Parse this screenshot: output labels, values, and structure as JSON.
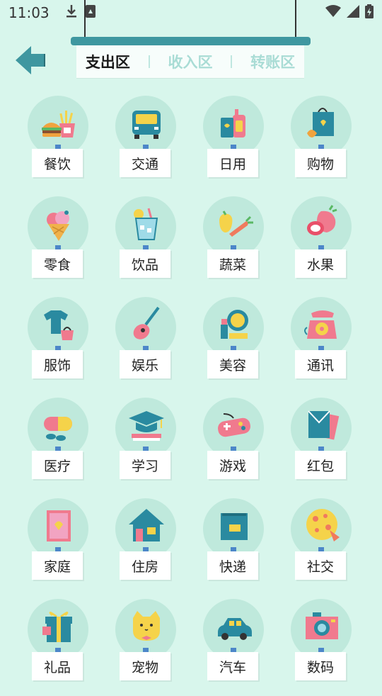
{
  "status_bar": {
    "time": "11:03"
  },
  "tabs": [
    {
      "label": "支出区",
      "active": true
    },
    {
      "label": "收入区",
      "active": false
    },
    {
      "label": "转账区",
      "active": false
    }
  ],
  "categories": [
    {
      "label": "餐饮",
      "icon": "burger-fries-icon"
    },
    {
      "label": "交通",
      "icon": "bus-icon"
    },
    {
      "label": "日用",
      "icon": "daily-goods-icon"
    },
    {
      "label": "购物",
      "icon": "shopping-bag-icon"
    },
    {
      "label": "零食",
      "icon": "ice-cream-icon"
    },
    {
      "label": "饮品",
      "icon": "drink-cup-icon"
    },
    {
      "label": "蔬菜",
      "icon": "vegetables-icon"
    },
    {
      "label": "水果",
      "icon": "strawberry-icon"
    },
    {
      "label": "服饰",
      "icon": "clothes-icon"
    },
    {
      "label": "娱乐",
      "icon": "guitar-icon"
    },
    {
      "label": "美容",
      "icon": "cosmetics-icon"
    },
    {
      "label": "通讯",
      "icon": "telephone-icon"
    },
    {
      "label": "医疗",
      "icon": "pill-icon"
    },
    {
      "label": "学习",
      "icon": "graduation-cap-icon"
    },
    {
      "label": "游戏",
      "icon": "gamepad-icon"
    },
    {
      "label": "红包",
      "icon": "red-envelope-icon"
    },
    {
      "label": "家庭",
      "icon": "family-frame-icon"
    },
    {
      "label": "住房",
      "icon": "house-icon"
    },
    {
      "label": "快递",
      "icon": "parcel-icon"
    },
    {
      "label": "社交",
      "icon": "pizza-icon"
    },
    {
      "label": "礼品",
      "icon": "gift-icon"
    },
    {
      "label": "宠物",
      "icon": "cat-icon"
    },
    {
      "label": "汽车",
      "icon": "car-icon"
    },
    {
      "label": "数码",
      "icon": "camera-icon"
    }
  ],
  "colors": {
    "background": "#d8f6ec",
    "accent": "#3f97a0",
    "circle": "#bfe9dc",
    "inactive_tab": "#a9dcd5"
  }
}
